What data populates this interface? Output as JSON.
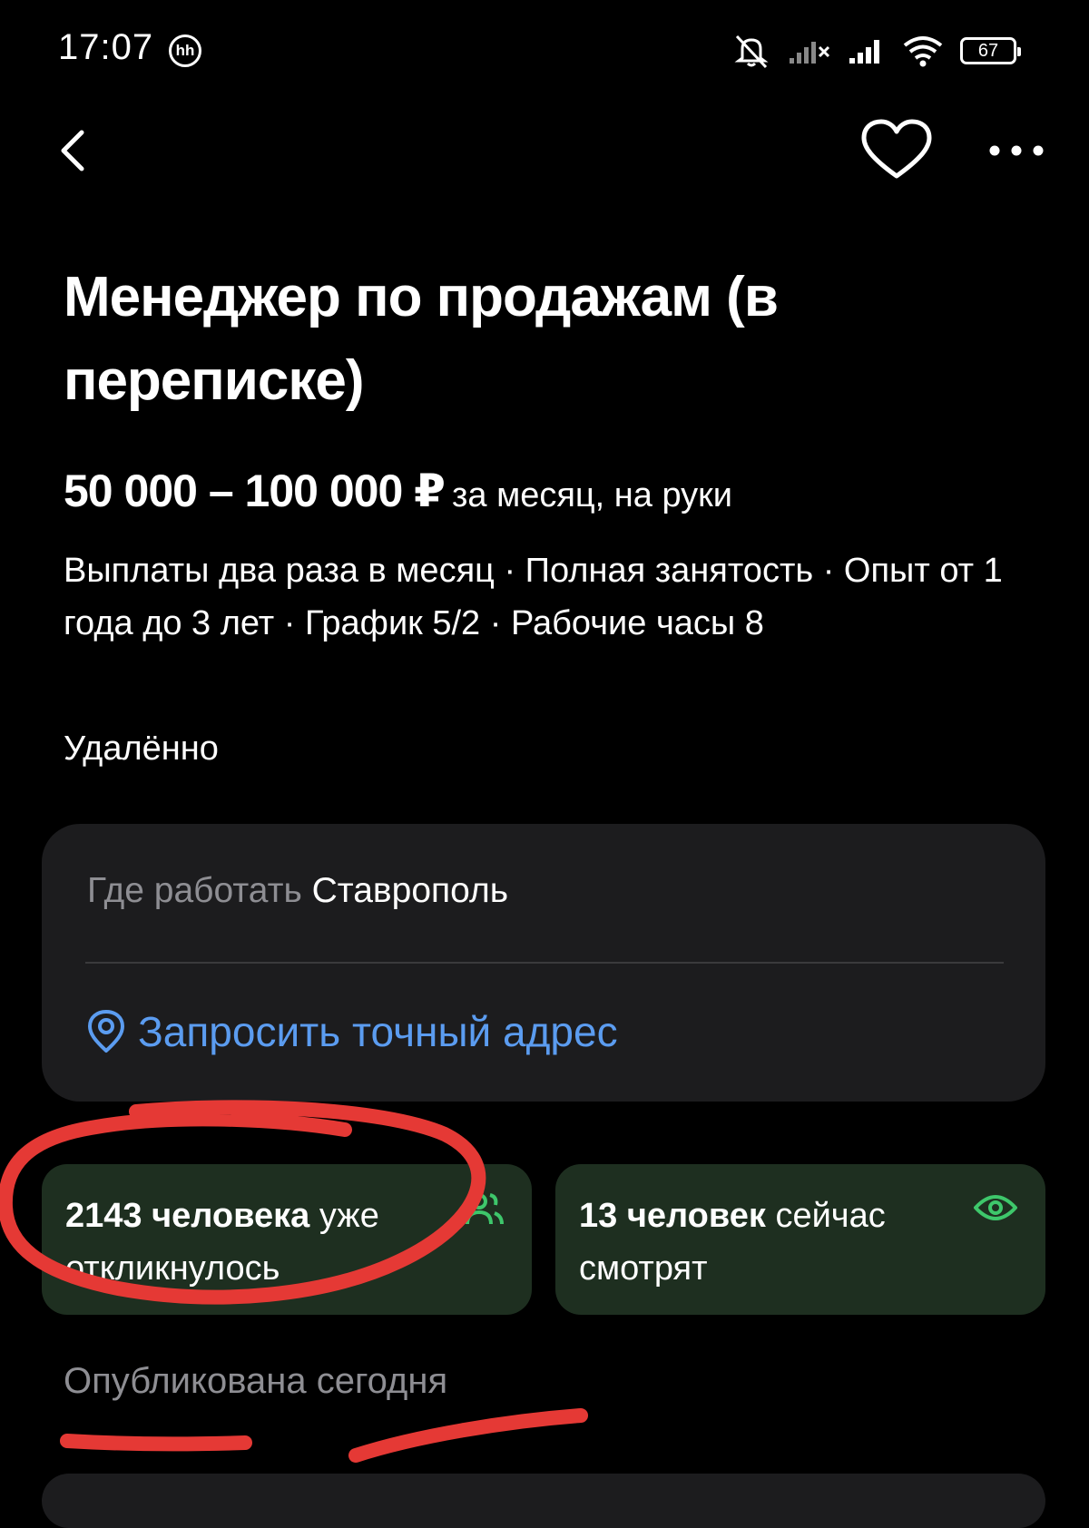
{
  "status_bar": {
    "time": "17:07",
    "notification_icon": "hh-icon",
    "hh_label": "hh",
    "battery": "67",
    "icons": [
      "bell-muted-icon",
      "signal-bars-icon",
      "signal-bars-icon",
      "wifi-icon",
      "battery-icon"
    ]
  },
  "nav": {
    "back_icon": "chevron-left-icon",
    "favorite_icon": "heart-icon",
    "more_icon": "more-horizontal-icon"
  },
  "vacancy": {
    "title": "Менеджер по продажам (в переписке)",
    "salary_amount": "50 000 – 100 000 ₽",
    "salary_note": "за месяц, на руки",
    "conditions": "Выплаты два раза в месяц · Полная занятость · Опыт от 1 года до 3 лет · График 5/2 · Рабочие часы 8",
    "work_format": "Удалённо"
  },
  "location": {
    "label": "Где работать",
    "city": "Ставрополь",
    "address_link": "Запросить точный адрес",
    "address_icon": "location-pin-icon"
  },
  "stats": {
    "responses_count": "2143 человека",
    "responses_rest": " уже откликнулось",
    "responses_icon": "people-icon",
    "viewers_count": "13 человек",
    "viewers_rest": " сейчас смотрят",
    "viewers_icon": "eye-icon"
  },
  "published": "Опубликована сегодня",
  "colors": {
    "background": "#000000",
    "card": "#1c1c1e",
    "stat_card": "#1e2f20",
    "link": "#5b9cf0",
    "accent_green": "#3ec76b",
    "muted_text": "#8e8e93",
    "annotation_red": "#e53935"
  }
}
